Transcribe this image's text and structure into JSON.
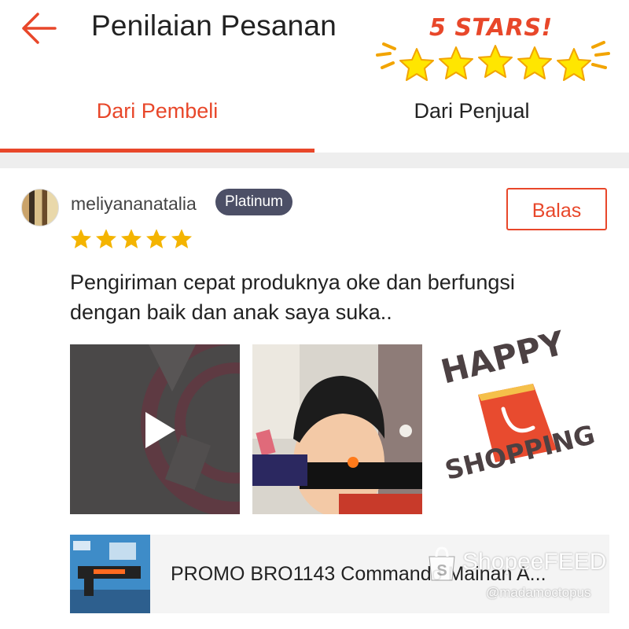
{
  "header": {
    "title": "Penilaian Pesanan",
    "back_icon": "arrow-left-icon"
  },
  "sticker": {
    "stars_text": "5 STARS!",
    "star_count": 5
  },
  "tabs": [
    {
      "label": "Dari Pembeli",
      "active": true
    },
    {
      "label": "Dari Penjual",
      "active": false
    }
  ],
  "review": {
    "username": "meliyananatalia",
    "badge": "Platinum",
    "reply_label": "Balas",
    "rating": 5,
    "text": "Pengiriman cepat produknya oke dan berfungsi dengan baik dan anak saya suka.."
  },
  "media": [
    {
      "type": "video",
      "icon": "play-icon"
    },
    {
      "type": "photo"
    }
  ],
  "happy_sticker": {
    "line1": "HAPPY",
    "line2": "SHOPPING",
    "icon": "shopping-bag-icon"
  },
  "product": {
    "name": "PROMO BRO1143 Commando Mainan A..."
  },
  "watermark": {
    "brand": "ShopeeFEED",
    "handle": "@madamoctopus"
  },
  "colors": {
    "accent": "#e8472a",
    "star": "#f4b400",
    "badge": "#4c4f66",
    "sticker_star": "#ffe600"
  }
}
